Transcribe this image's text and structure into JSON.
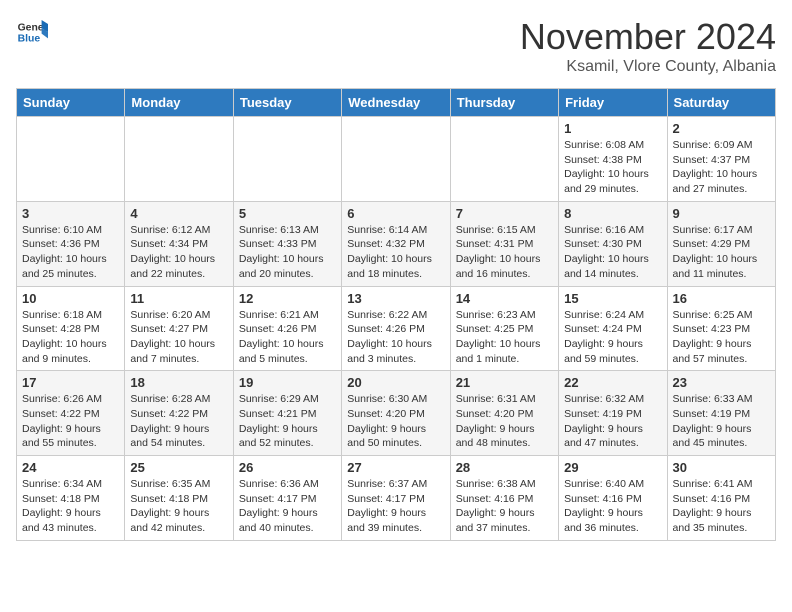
{
  "logo": {
    "general": "General",
    "blue": "Blue"
  },
  "title": "November 2024",
  "subtitle": "Ksamil, Vlore County, Albania",
  "headers": [
    "Sunday",
    "Monday",
    "Tuesday",
    "Wednesday",
    "Thursday",
    "Friday",
    "Saturday"
  ],
  "weeks": [
    [
      {
        "day": "",
        "info": ""
      },
      {
        "day": "",
        "info": ""
      },
      {
        "day": "",
        "info": ""
      },
      {
        "day": "",
        "info": ""
      },
      {
        "day": "",
        "info": ""
      },
      {
        "day": "1",
        "info": "Sunrise: 6:08 AM\nSunset: 4:38 PM\nDaylight: 10 hours and 29 minutes."
      },
      {
        "day": "2",
        "info": "Sunrise: 6:09 AM\nSunset: 4:37 PM\nDaylight: 10 hours and 27 minutes."
      }
    ],
    [
      {
        "day": "3",
        "info": "Sunrise: 6:10 AM\nSunset: 4:36 PM\nDaylight: 10 hours and 25 minutes."
      },
      {
        "day": "4",
        "info": "Sunrise: 6:12 AM\nSunset: 4:34 PM\nDaylight: 10 hours and 22 minutes."
      },
      {
        "day": "5",
        "info": "Sunrise: 6:13 AM\nSunset: 4:33 PM\nDaylight: 10 hours and 20 minutes."
      },
      {
        "day": "6",
        "info": "Sunrise: 6:14 AM\nSunset: 4:32 PM\nDaylight: 10 hours and 18 minutes."
      },
      {
        "day": "7",
        "info": "Sunrise: 6:15 AM\nSunset: 4:31 PM\nDaylight: 10 hours and 16 minutes."
      },
      {
        "day": "8",
        "info": "Sunrise: 6:16 AM\nSunset: 4:30 PM\nDaylight: 10 hours and 14 minutes."
      },
      {
        "day": "9",
        "info": "Sunrise: 6:17 AM\nSunset: 4:29 PM\nDaylight: 10 hours and 11 minutes."
      }
    ],
    [
      {
        "day": "10",
        "info": "Sunrise: 6:18 AM\nSunset: 4:28 PM\nDaylight: 10 hours and 9 minutes."
      },
      {
        "day": "11",
        "info": "Sunrise: 6:20 AM\nSunset: 4:27 PM\nDaylight: 10 hours and 7 minutes."
      },
      {
        "day": "12",
        "info": "Sunrise: 6:21 AM\nSunset: 4:26 PM\nDaylight: 10 hours and 5 minutes."
      },
      {
        "day": "13",
        "info": "Sunrise: 6:22 AM\nSunset: 4:26 PM\nDaylight: 10 hours and 3 minutes."
      },
      {
        "day": "14",
        "info": "Sunrise: 6:23 AM\nSunset: 4:25 PM\nDaylight: 10 hours and 1 minute."
      },
      {
        "day": "15",
        "info": "Sunrise: 6:24 AM\nSunset: 4:24 PM\nDaylight: 9 hours and 59 minutes."
      },
      {
        "day": "16",
        "info": "Sunrise: 6:25 AM\nSunset: 4:23 PM\nDaylight: 9 hours and 57 minutes."
      }
    ],
    [
      {
        "day": "17",
        "info": "Sunrise: 6:26 AM\nSunset: 4:22 PM\nDaylight: 9 hours and 55 minutes."
      },
      {
        "day": "18",
        "info": "Sunrise: 6:28 AM\nSunset: 4:22 PM\nDaylight: 9 hours and 54 minutes."
      },
      {
        "day": "19",
        "info": "Sunrise: 6:29 AM\nSunset: 4:21 PM\nDaylight: 9 hours and 52 minutes."
      },
      {
        "day": "20",
        "info": "Sunrise: 6:30 AM\nSunset: 4:20 PM\nDaylight: 9 hours and 50 minutes."
      },
      {
        "day": "21",
        "info": "Sunrise: 6:31 AM\nSunset: 4:20 PM\nDaylight: 9 hours and 48 minutes."
      },
      {
        "day": "22",
        "info": "Sunrise: 6:32 AM\nSunset: 4:19 PM\nDaylight: 9 hours and 47 minutes."
      },
      {
        "day": "23",
        "info": "Sunrise: 6:33 AM\nSunset: 4:19 PM\nDaylight: 9 hours and 45 minutes."
      }
    ],
    [
      {
        "day": "24",
        "info": "Sunrise: 6:34 AM\nSunset: 4:18 PM\nDaylight: 9 hours and 43 minutes."
      },
      {
        "day": "25",
        "info": "Sunrise: 6:35 AM\nSunset: 4:18 PM\nDaylight: 9 hours and 42 minutes."
      },
      {
        "day": "26",
        "info": "Sunrise: 6:36 AM\nSunset: 4:17 PM\nDaylight: 9 hours and 40 minutes."
      },
      {
        "day": "27",
        "info": "Sunrise: 6:37 AM\nSunset: 4:17 PM\nDaylight: 9 hours and 39 minutes."
      },
      {
        "day": "28",
        "info": "Sunrise: 6:38 AM\nSunset: 4:16 PM\nDaylight: 9 hours and 37 minutes."
      },
      {
        "day": "29",
        "info": "Sunrise: 6:40 AM\nSunset: 4:16 PM\nDaylight: 9 hours and 36 minutes."
      },
      {
        "day": "30",
        "info": "Sunrise: 6:41 AM\nSunset: 4:16 PM\nDaylight: 9 hours and 35 minutes."
      }
    ]
  ]
}
